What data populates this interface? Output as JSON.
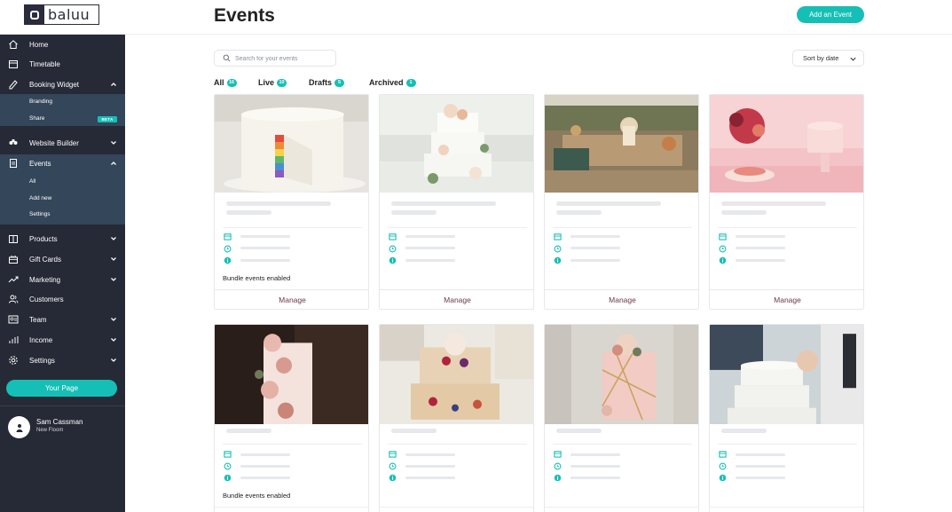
{
  "app": {
    "logo_text": "baluu",
    "page_title": "Events",
    "add_event_label": "Add an Event"
  },
  "colors": {
    "accent": "#15bfb5",
    "sidebar_bg": "#262936",
    "sidebar_active": "#344659",
    "manage_text": "#6a3a4a"
  },
  "sidebar": {
    "items": [
      {
        "label": "Home",
        "icon": "home-icon"
      },
      {
        "label": "Timetable",
        "icon": "calendar-icon"
      },
      {
        "label": "Booking Widget",
        "icon": "widget-icon"
      },
      {
        "label": "Website Builder",
        "icon": "website-icon"
      },
      {
        "label": "Events",
        "icon": "document-icon"
      },
      {
        "label": "Products",
        "icon": "products-icon"
      },
      {
        "label": "Gift Cards",
        "icon": "gift-icon"
      },
      {
        "label": "Marketing",
        "icon": "trend-icon"
      },
      {
        "label": "Customers",
        "icon": "users-icon"
      },
      {
        "label": "Team",
        "icon": "team-icon"
      },
      {
        "label": "Income",
        "icon": "income-icon"
      },
      {
        "label": "Settings",
        "icon": "gear-icon"
      }
    ],
    "booking_sub": [
      "Branding",
      "Share"
    ],
    "beta_label": "BETA",
    "events_sub": [
      "All",
      "Add new",
      "Settings"
    ],
    "your_page_label": "Your Page",
    "user": {
      "name": "Sam Cassman",
      "sub": "New Floom"
    }
  },
  "search": {
    "placeholder": "Search for your events"
  },
  "sort": {
    "label": "Sort by date"
  },
  "tabs": [
    {
      "label": "All",
      "count": "16"
    },
    {
      "label": "Live",
      "count": "10"
    },
    {
      "label": "Drafts",
      "count": "5"
    },
    {
      "label": "Archived",
      "count": "1"
    }
  ],
  "cards": [
    {
      "image": "layered-rainbow-cake",
      "bundle": "Bundle events enabled",
      "manage": "Manage"
    },
    {
      "image": "white-tiered-floral-cake",
      "bundle": "",
      "manage": "Manage"
    },
    {
      "image": "outdoor-dessert-table",
      "bundle": "",
      "manage": "Manage"
    },
    {
      "image": "pink-flower-cake-table",
      "bundle": "",
      "manage": "Manage"
    },
    {
      "image": "pink-rose-cake",
      "bundle": "Bundle events enabled",
      "manage": ""
    },
    {
      "image": "naked-berry-cake",
      "bundle": "",
      "manage": ""
    },
    {
      "image": "pink-gold-cake",
      "bundle": "",
      "manage": ""
    },
    {
      "image": "wedding-cake-cutting",
      "bundle": "",
      "manage": ""
    }
  ]
}
